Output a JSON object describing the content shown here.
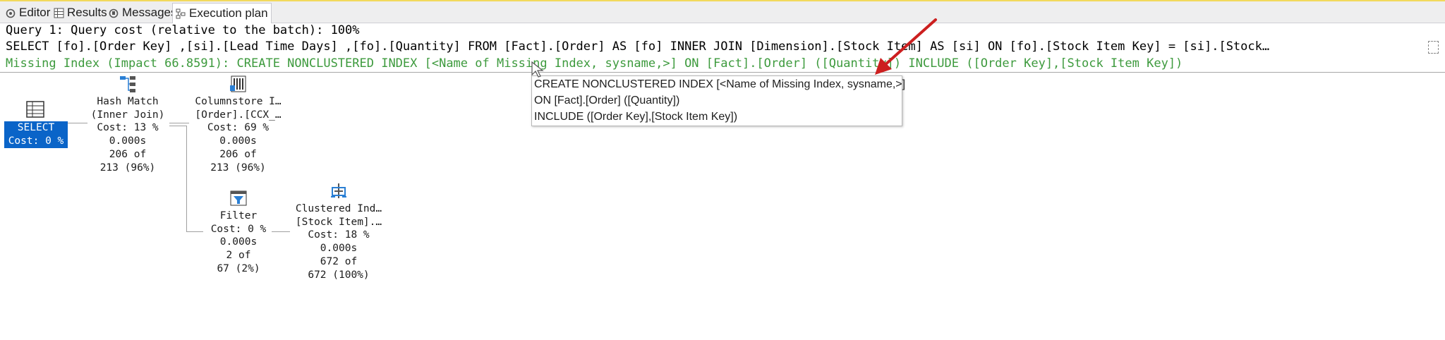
{
  "tabs": [
    {
      "label": "Editor",
      "icon": "editor-icon"
    },
    {
      "label": "Results",
      "icon": "grid-icon"
    },
    {
      "label": "Messages",
      "icon": "messages-icon"
    },
    {
      "label": "Execution plan",
      "icon": "plan-icon"
    }
  ],
  "query": {
    "header": "Query 1: Query cost (relative to the batch): 100%",
    "sql": "SELECT [fo].[Order Key] ,[si].[Lead Time Days] ,[fo].[Quantity] FROM [Fact].[Order] AS [fo] INNER JOIN [Dimension].[Stock Item] AS [si] ON [fo].[Stock Item Key] = [si].[Stock…",
    "missing_index": "Missing Index (Impact 66.8591): CREATE NONCLUSTERED INDEX [<Name of Missing Index, sysname,>] ON [Fact].[Order] ([Quantity]) INCLUDE ([Order Key],[Stock Item Key])"
  },
  "plan": {
    "select": {
      "title": "SELECT",
      "cost": "Cost: 0 %",
      "icon": "select-icon"
    },
    "hash_match": {
      "title": "Hash Match",
      "sub": "(Inner Join)",
      "cost": "Cost: 13 %",
      "time": "0.000s",
      "rows1": "206 of",
      "rows2": "213 (96%)",
      "icon": "hash-match-icon"
    },
    "columnstore": {
      "title": "Columnstore I…",
      "sub": "[Order].[CCX_…",
      "cost": "Cost: 69 %",
      "time": "0.000s",
      "rows1": "206 of",
      "rows2": "213 (96%)",
      "icon": "columnstore-icon"
    },
    "filter": {
      "title": "Filter",
      "cost": "Cost: 0 %",
      "time": "0.000s",
      "rows1": "2 of",
      "rows2": "67 (2%)",
      "icon": "filter-icon"
    },
    "clustered": {
      "title": "Clustered Ind…",
      "sub": "[Stock Item].…",
      "cost": "Cost: 18 %",
      "time": "0.000s",
      "rows1": "672 of",
      "rows2": "672 (100%)",
      "icon": "clustered-index-icon"
    }
  },
  "tooltip": {
    "line1": "CREATE NONCLUSTERED INDEX [<Name of Missing Index, sysname,>]",
    "line2": "ON [Fact].[Order] ([Quantity])",
    "line3": "INCLUDE ([Order Key],[Stock Item Key])"
  },
  "colors": {
    "accent": "#0a64c8",
    "missing_index": "#3d9a3d",
    "arrow": "#cc1f1f"
  }
}
